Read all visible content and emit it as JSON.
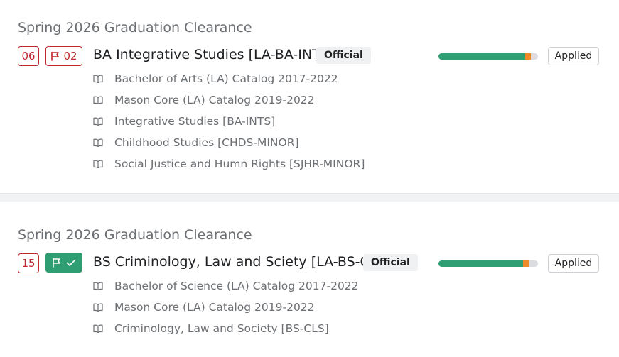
{
  "colors": {
    "accent_green": "#2f9e73",
    "accent_red": "#c0262d",
    "accent_orange": "#ef8a2a",
    "muted_text": "#6c6f73"
  },
  "records": [
    {
      "term_title": "Spring 2026 Graduation Clearance",
      "count_badge": "06",
      "flag_badge": {
        "icon": "flag-icon",
        "label": "02",
        "status": "outlined-red"
      },
      "program": "BA Integrative Studies [LA-BA-INTS]",
      "status_tag": "Official",
      "progress": {
        "green_fraction": 0.87,
        "orange_fraction": 0.06
      },
      "action_label": "Applied",
      "requirements": [
        "Bachelor of Arts (LA) Catalog 2017-2022",
        "Mason Core (LA) Catalog 2019-2022",
        "Integrative Studies [BA-INTS]",
        "Childhood Studies [CHDS-MINOR]",
        "Social Justice and Humn Rights [SJHR-MINOR]"
      ]
    },
    {
      "term_title": "Spring 2026 Graduation Clearance",
      "count_badge": "15",
      "flag_badge": {
        "icon": "flag-check-icon",
        "label": "",
        "status": "filled-green"
      },
      "program": "BS Criminology, Law and Sciety [LA-BS-CLS]",
      "status_tag": "Official",
      "progress": {
        "green_fraction": 0.85,
        "orange_fraction": 0.06
      },
      "action_label": "Applied",
      "requirements": [
        "Bachelor of Science (LA) Catalog 2017-2022",
        "Mason Core (LA) Catalog 2019-2022",
        "Criminology, Law and Society [BS-CLS]"
      ]
    }
  ]
}
